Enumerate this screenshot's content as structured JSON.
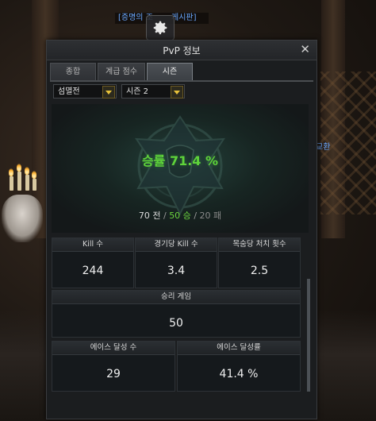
{
  "notice": {
    "left": "[증명의 조",
    "right": "게시판]"
  },
  "side_link": "교환",
  "window": {
    "title": "PvP 정보",
    "close": "✕",
    "tabs": [
      {
        "label": "종합",
        "active": false
      },
      {
        "label": "계급 점수",
        "active": false
      },
      {
        "label": "시즌",
        "active": true
      }
    ],
    "filters": {
      "mode": "섬멸전",
      "season": "시즌 2"
    },
    "hero": {
      "winrate": "승률 71.4 %",
      "games": "70 전",
      "sep1": "/",
      "wins": "50 승",
      "sep2": "/",
      "losses": "20 패"
    },
    "stats": {
      "kill": {
        "label": "Kill 수",
        "value": "244"
      },
      "kill_per_game": {
        "label": "경기당 Kill 수",
        "value": "3.4"
      },
      "bounty_kills": {
        "label": "목숨당 처치 횟수",
        "value": "2.5"
      },
      "win_games": {
        "label": "승리 게임",
        "value": "50"
      },
      "ace_count": {
        "label": "에이스 달성 수",
        "value": "29"
      },
      "ace_rate": {
        "label": "에이스 달성률",
        "value": "41.4 %"
      }
    }
  },
  "colors": {
    "win": "#5fd33a",
    "loss": "#8a8a8a",
    "link": "#6aa8ff",
    "accent": "#e7c23b"
  }
}
